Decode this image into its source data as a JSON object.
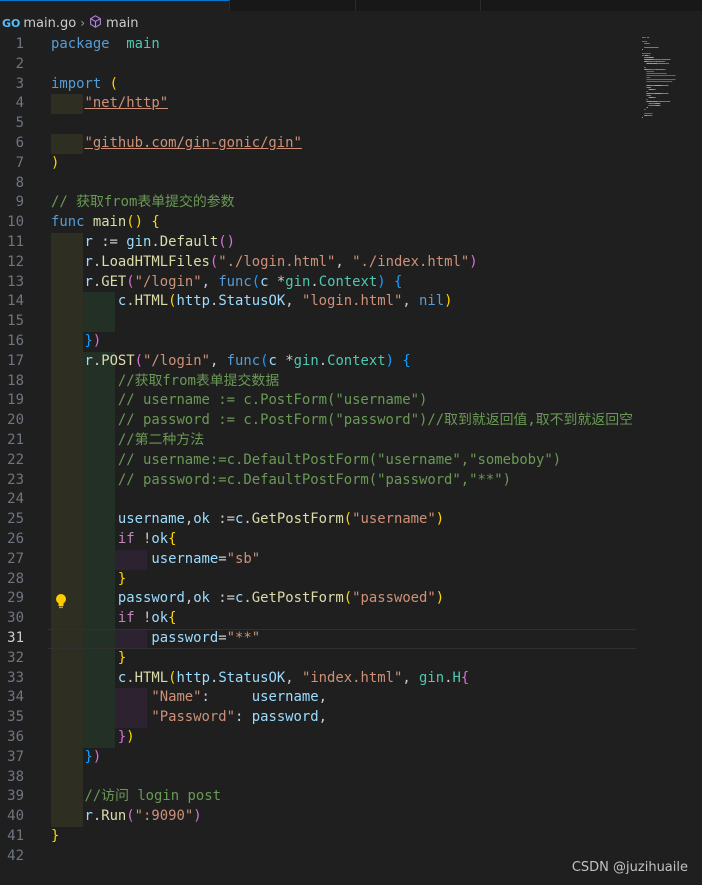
{
  "breadcrumb": {
    "file": "main.go",
    "go_badge": "GO",
    "symbol": "main"
  },
  "editor": {
    "current_line": 31,
    "lines": [
      [
        [
          "kw",
          "package"
        ],
        [
          "",
          "  "
        ],
        [
          "ty",
          "main"
        ]
      ],
      [],
      [
        [
          "kw",
          "import"
        ],
        [
          "",
          " "
        ],
        [
          "br1",
          "("
        ]
      ],
      [
        [
          "",
          "    "
        ],
        [
          "str",
          "\"net/http\""
        ]
      ],
      [],
      [
        [
          "",
          "    "
        ],
        [
          "str",
          "\"github.com/gin-gonic/gin\""
        ]
      ],
      [
        [
          "br1",
          ")"
        ]
      ],
      [],
      [
        [
          "cm",
          "// 获取from表单提交的参数"
        ]
      ],
      [
        [
          "kw",
          "func"
        ],
        [
          "",
          " "
        ],
        [
          "fn",
          "main"
        ],
        [
          "br1",
          "()"
        ],
        [
          "",
          " "
        ],
        [
          "br1",
          "{"
        ]
      ],
      [
        [
          "",
          "    "
        ],
        [
          "vr",
          "r"
        ],
        [
          "",
          " := "
        ],
        [
          "vr",
          "gin"
        ],
        [
          "",
          "."
        ],
        [
          "fn",
          "Default"
        ],
        [
          "br2",
          "()"
        ]
      ],
      [
        [
          "",
          "    "
        ],
        [
          "vr",
          "r"
        ],
        [
          "",
          "."
        ],
        [
          "fn",
          "LoadHTMLFiles"
        ],
        [
          "br2",
          "("
        ],
        [
          "str",
          "\"./login.html\""
        ],
        [
          "",
          ", "
        ],
        [
          "str",
          "\"./index.html\""
        ],
        [
          "br2",
          ")"
        ]
      ],
      [
        [
          "",
          "    "
        ],
        [
          "vr",
          "r"
        ],
        [
          "",
          "."
        ],
        [
          "fn",
          "GET"
        ],
        [
          "br2",
          "("
        ],
        [
          "str",
          "\"/login\""
        ],
        [
          "",
          ", "
        ],
        [
          "kw",
          "func"
        ],
        [
          "br3",
          "("
        ],
        [
          "vr",
          "c"
        ],
        [
          "",
          " *"
        ],
        [
          "ty",
          "gin"
        ],
        [
          "",
          "."
        ],
        [
          "ty",
          "Context"
        ],
        [
          "br3",
          ")"
        ],
        [
          "",
          " "
        ],
        [
          "br3",
          "{"
        ]
      ],
      [
        [
          "",
          "        "
        ],
        [
          "vr",
          "c"
        ],
        [
          "",
          "."
        ],
        [
          "fn",
          "HTML"
        ],
        [
          "br1",
          "("
        ],
        [
          "vr",
          "http"
        ],
        [
          "",
          "."
        ],
        [
          "vr",
          "StatusOK"
        ],
        [
          "",
          ", "
        ],
        [
          "str",
          "\"login.html\""
        ],
        [
          "",
          ", "
        ],
        [
          "kw",
          "nil"
        ],
        [
          "br1",
          ")"
        ]
      ],
      [],
      [
        [
          "",
          "    "
        ],
        [
          "br3",
          "}"
        ],
        [
          "br2",
          ")"
        ]
      ],
      [
        [
          "",
          "    "
        ],
        [
          "vr",
          "r"
        ],
        [
          "",
          "."
        ],
        [
          "fn",
          "POST"
        ],
        [
          "br2",
          "("
        ],
        [
          "str",
          "\"/login\""
        ],
        [
          "",
          ", "
        ],
        [
          "kw",
          "func"
        ],
        [
          "br3",
          "("
        ],
        [
          "vr",
          "c"
        ],
        [
          "",
          " *"
        ],
        [
          "ty",
          "gin"
        ],
        [
          "",
          "."
        ],
        [
          "ty",
          "Context"
        ],
        [
          "br3",
          ")"
        ],
        [
          "",
          " "
        ],
        [
          "br3",
          "{"
        ]
      ],
      [
        [
          "",
          "        "
        ],
        [
          "cm",
          "//获取from表单提交数据"
        ]
      ],
      [
        [
          "",
          "        "
        ],
        [
          "cm",
          "// username := c.PostForm(\"username\")"
        ]
      ],
      [
        [
          "",
          "        "
        ],
        [
          "cm",
          "// password := c.PostForm(\"password\")//取到就返回值,取不到就返回空"
        ]
      ],
      [
        [
          "",
          "        "
        ],
        [
          "cm",
          "//第二种方法"
        ]
      ],
      [
        [
          "",
          "        "
        ],
        [
          "cm",
          "// username:=c.DefaultPostForm(\"username\",\"someboby\")"
        ]
      ],
      [
        [
          "",
          "        "
        ],
        [
          "cm",
          "// password:=c.DefaultPostForm(\"password\",\"**\")"
        ]
      ],
      [],
      [
        [
          "",
          "        "
        ],
        [
          "vr",
          "username"
        ],
        [
          "",
          ","
        ],
        [
          "vr",
          "ok"
        ],
        [
          "",
          " :="
        ],
        [
          "vr",
          "c"
        ],
        [
          "",
          "."
        ],
        [
          "fn",
          "GetPostForm"
        ],
        [
          "br1",
          "("
        ],
        [
          "str",
          "\"username\""
        ],
        [
          "br1",
          ")"
        ]
      ],
      [
        [
          "",
          "        "
        ],
        [
          "cf",
          "if"
        ],
        [
          "",
          " !"
        ],
        [
          "vr",
          "ok"
        ],
        [
          "br1",
          "{"
        ]
      ],
      [
        [
          "",
          "            "
        ],
        [
          "vr",
          "username"
        ],
        [
          "",
          "="
        ],
        [
          "str",
          "\"sb\""
        ]
      ],
      [
        [
          "",
          "        "
        ],
        [
          "br1",
          "}"
        ]
      ],
      [
        [
          "",
          "        "
        ],
        [
          "vr",
          "password"
        ],
        [
          "",
          ","
        ],
        [
          "vr",
          "ok"
        ],
        [
          "",
          " :="
        ],
        [
          "vr",
          "c"
        ],
        [
          "",
          "."
        ],
        [
          "fn",
          "GetPostForm"
        ],
        [
          "br1",
          "("
        ],
        [
          "str",
          "\"passwoed\""
        ],
        [
          "br1",
          ")"
        ]
      ],
      [
        [
          "",
          "        "
        ],
        [
          "cf",
          "if"
        ],
        [
          "",
          " !"
        ],
        [
          "vr",
          "ok"
        ],
        [
          "br1",
          "{"
        ]
      ],
      [
        [
          "",
          "            "
        ],
        [
          "vr",
          "password"
        ],
        [
          "",
          "="
        ],
        [
          "str",
          "\"**\""
        ]
      ],
      [
        [
          "",
          "        "
        ],
        [
          "br1",
          "}"
        ]
      ],
      [
        [
          "",
          "        "
        ],
        [
          "vr",
          "c"
        ],
        [
          "",
          "."
        ],
        [
          "fn",
          "HTML"
        ],
        [
          "br1",
          "("
        ],
        [
          "vr",
          "http"
        ],
        [
          "",
          "."
        ],
        [
          "vr",
          "StatusOK"
        ],
        [
          "",
          ", "
        ],
        [
          "str",
          "\"index.html\""
        ],
        [
          "",
          ", "
        ],
        [
          "ty",
          "gin"
        ],
        [
          "",
          "."
        ],
        [
          "ty",
          "H"
        ],
        [
          "br2",
          "{"
        ]
      ],
      [
        [
          "",
          "            "
        ],
        [
          "str",
          "\"Name\""
        ],
        [
          "",
          ":     "
        ],
        [
          "vr",
          "username"
        ],
        [
          "",
          ","
        ]
      ],
      [
        [
          "",
          "            "
        ],
        [
          "str",
          "\"Password\""
        ],
        [
          "",
          ": "
        ],
        [
          "vr",
          "password"
        ],
        [
          "",
          ","
        ]
      ],
      [
        [
          "",
          "        "
        ],
        [
          "br2",
          "}"
        ],
        [
          "br1",
          ")"
        ]
      ],
      [
        [
          "",
          "    "
        ],
        [
          "br3",
          "}"
        ],
        [
          "br2",
          ")"
        ]
      ],
      [],
      [
        [
          "",
          "    "
        ],
        [
          "cm",
          "//访问 login post"
        ]
      ],
      [
        [
          "",
          "    "
        ],
        [
          "vr",
          "r"
        ],
        [
          "",
          "."
        ],
        [
          "fn",
          "Run"
        ],
        [
          "br2",
          "("
        ],
        [
          "str",
          "\":9090\""
        ],
        [
          "br2",
          ")"
        ]
      ],
      [
        [
          "br1",
          "}"
        ]
      ],
      []
    ]
  },
  "watermark": "CSDN @juzihuaile"
}
